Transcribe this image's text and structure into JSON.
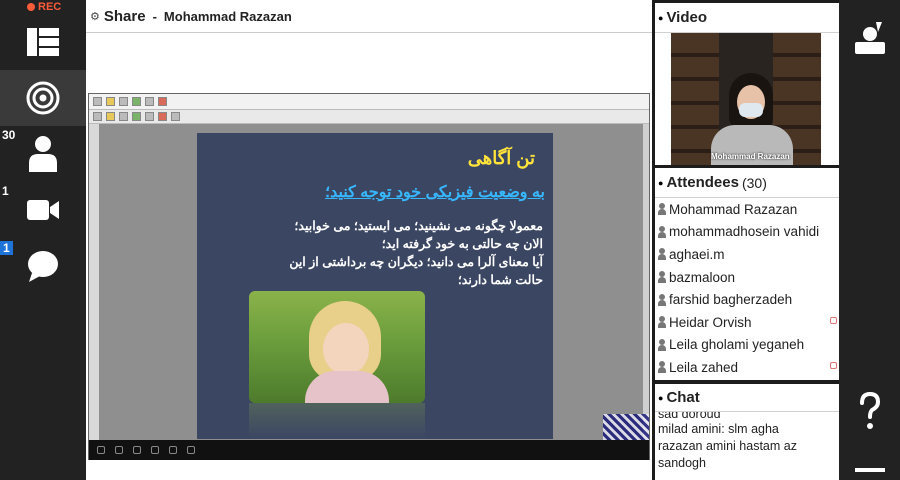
{
  "recording": {
    "label": "REC",
    "color": "#ff5b3a"
  },
  "left_rail": {
    "items": [
      {
        "icon": "layout-icon"
      },
      {
        "icon": "target-icon"
      },
      {
        "icon": "attendee-icon",
        "count": "30"
      },
      {
        "icon": "camera-icon",
        "count": "1"
      },
      {
        "icon": "chat-bubble-icon",
        "count": "1"
      }
    ]
  },
  "share": {
    "icon": "share-gear-icon",
    "title": "Share",
    "separator": "-",
    "presenter": "Mohammad Razazan"
  },
  "slide": {
    "title": "تن آگاهی",
    "subtitle": "به وضعیت فیزیکی خود توجه کنید؛",
    "lines": [
      "معمولا چگونه می نشینید؛ می ایستید؛ می خوابید؛",
      "الان چه حالتی به خود گرفته اید؛",
      "آیا معنای آلرا می دانید؛ دیگران چه برداشتی از این",
      "حالت شما دارند؛"
    ],
    "colors": {
      "background": "#3b4663",
      "title": "#ffe33a",
      "subtitle": "#37b7ff"
    }
  },
  "video": {
    "title": "Video",
    "participant": "Mohammad Razazan"
  },
  "attendees": {
    "title": "Attendees",
    "count": "(30)",
    "list": [
      "Mohammad Razazan",
      "mohammadhosein vahidi",
      "aghaei.m",
      "bazmaloon",
      "farshid bagherzadeh",
      "Heidar Orvish",
      "Leila gholami yeganeh",
      "Leila zahed"
    ]
  },
  "chat": {
    "title": "Chat",
    "messages": [
      "sad doroud",
      "milad amini: slm agha",
      "razazan amini hastam az",
      "sandogh"
    ]
  },
  "right_rail": {
    "items": [
      {
        "icon": "raise-hand-icon"
      },
      {
        "icon": "help-icon"
      },
      {
        "icon": "menu-icon"
      }
    ]
  }
}
